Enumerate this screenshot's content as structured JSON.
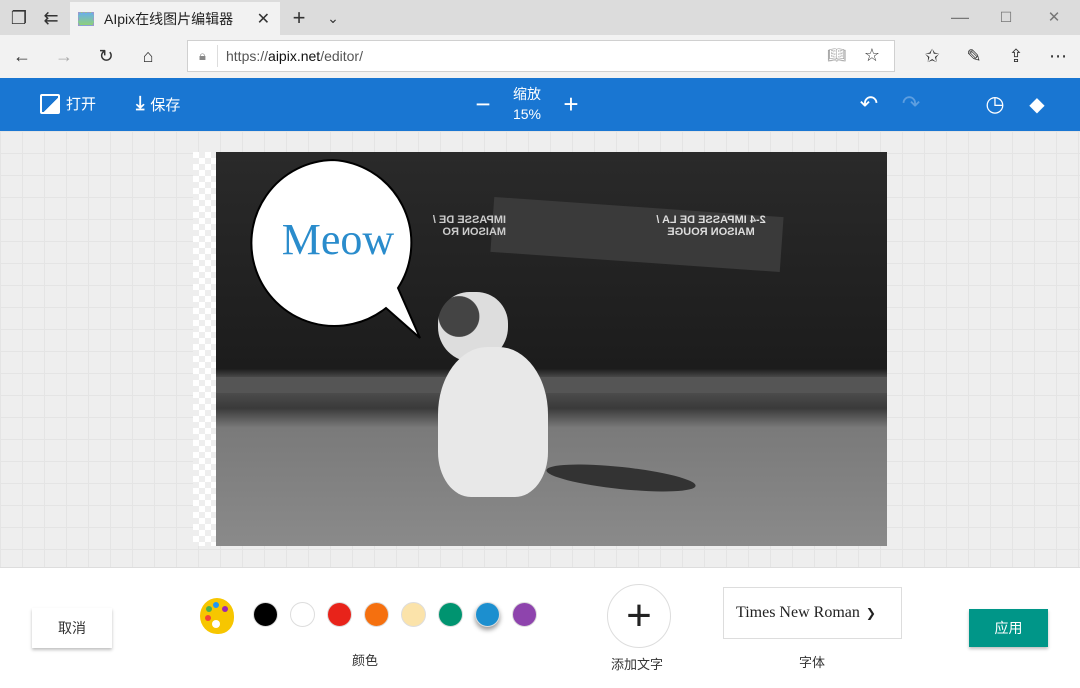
{
  "browser": {
    "tab_title": "AIpix在线图片编辑器",
    "url_prefix": "https://",
    "url_host": "aipix.net",
    "url_path": "/editor/"
  },
  "toolbar": {
    "open_label": "打开",
    "save_label": "保存",
    "zoom_label": "缩放",
    "zoom_value": "15%"
  },
  "canvas": {
    "bubble_text": "Meow",
    "sign_left": "IMPASSE DE / MAISON RO",
    "sign_right": "2-4 IMPASSE DE LA / MAISON ROUGE"
  },
  "bottom": {
    "cancel_label": "取消",
    "color_label": "颜色",
    "colors": [
      "#000000",
      "#ffffff",
      "#e8231a",
      "#f5700f",
      "#fbe3aa",
      "#009470",
      "#1c8fcf",
      "#8e44ad"
    ],
    "selected_color": "#1c8fcf",
    "add_text_label": "添加文字",
    "font_value": "Times New Roman",
    "font_label": "字体",
    "apply_label": "应用",
    "apply_color": "#009688"
  }
}
